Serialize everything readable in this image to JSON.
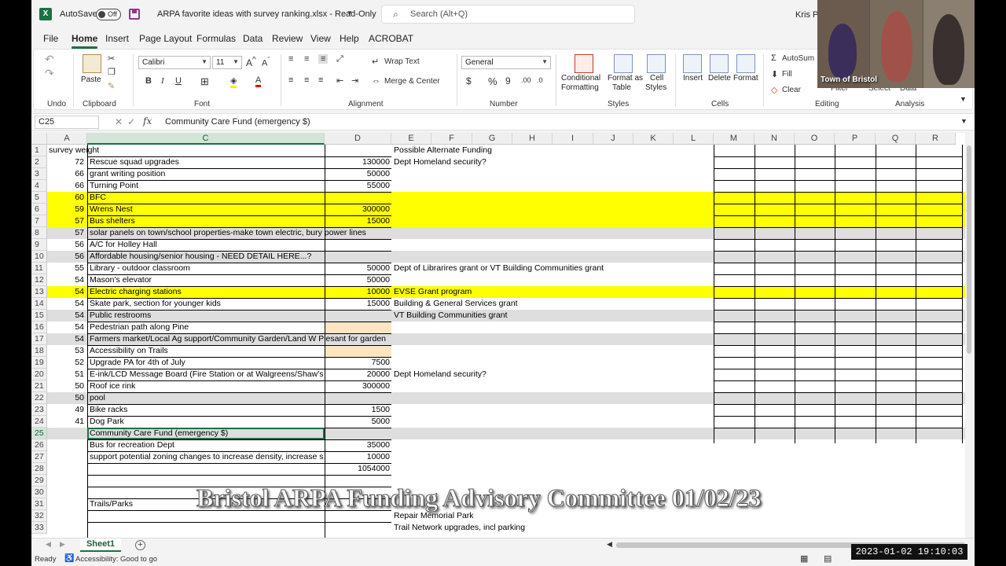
{
  "titlebar": {
    "autosave_label": "AutoSave",
    "autosave_state": "Off",
    "doc_title": "ARPA favorite ideas with survey ranking.xlsx  -  Read-Only",
    "search_placeholder": "Search (Alt+Q)",
    "user_name": "Kris Pe"
  },
  "menu": [
    "File",
    "Home",
    "Insert",
    "Page Layout",
    "Formulas",
    "Data",
    "Review",
    "View",
    "Help",
    "ACROBAT"
  ],
  "ribbon": {
    "undo_label": "Undo",
    "clipboard_label": "Clipboard",
    "paste_label": "Paste",
    "font_label": "Font",
    "font_name": "Calibri",
    "font_size": "11",
    "alignment_label": "Alignment",
    "wrap_text": "Wrap Text",
    "merge_center": "Merge & Center",
    "number_label": "Number",
    "number_format": "General",
    "styles_label": "Styles",
    "conditional_formatting": [
      "Conditional",
      "Formatting"
    ],
    "format_as_table": [
      "Format as",
      "Table"
    ],
    "cell_styles": [
      "Cell",
      "Styles"
    ],
    "cells_label": "Cells",
    "insert": "Insert",
    "delete": "Delete",
    "format": "Format",
    "editing_label": "Editing",
    "autosum": "AutoSum",
    "fill": "Fill",
    "clear": "Clear",
    "filter": "Filter",
    "select": "Select",
    "data": "Data",
    "analysis_label": "Analysis"
  },
  "formula_bar": {
    "name_box": "C25",
    "fx": "fx",
    "content": "Community Care Fund (emergency $)"
  },
  "columns": [
    "A",
    "C",
    "D",
    "E",
    "F",
    "G",
    "H",
    "I",
    "J",
    "K",
    "L",
    "M",
    "N",
    "O",
    "P",
    "Q",
    "R"
  ],
  "rows": [
    {
      "n": "1",
      "a": "survey weight",
      "c": "",
      "d": "",
      "e": "Possible Alternate Funding",
      "style": ""
    },
    {
      "n": "2",
      "a": "72",
      "c": "Rescue squad upgrades",
      "d": "130000",
      "e": "Dept Homeland security?",
      "style": ""
    },
    {
      "n": "3",
      "a": "66",
      "c": "grant writing position",
      "d": "50000",
      "e": "",
      "style": ""
    },
    {
      "n": "4",
      "a": "66",
      "c": "Turning Point",
      "d": "55000",
      "e": "",
      "style": ""
    },
    {
      "n": "5",
      "a": "60",
      "c": "BFC",
      "d": "",
      "e": "",
      "style": "yellow"
    },
    {
      "n": "6",
      "a": "59",
      "c": "Wrens Nest",
      "d": "300000",
      "e": "",
      "style": "yellow"
    },
    {
      "n": "7",
      "a": "57",
      "c": "Bus shelters",
      "d": "15000",
      "e": "",
      "style": "yellow"
    },
    {
      "n": "8",
      "a": "57",
      "c": "solar panels on town/school properties-make town electric, bury power lines",
      "d": "",
      "e": "",
      "style": "gray"
    },
    {
      "n": "9",
      "a": "56",
      "c": "A/C for Holley Hall",
      "d": "",
      "e": "",
      "style": ""
    },
    {
      "n": "10",
      "a": "56",
      "c": "Affordable housing/senior housing - NEED DETAIL HERE...?",
      "d": "",
      "e": "",
      "style": "gray"
    },
    {
      "n": "11",
      "a": "55",
      "c": "Library - outdoor classroom",
      "d": "50000",
      "e": "Dept of Librarires grant or VT Building Communities grant",
      "style": ""
    },
    {
      "n": "12",
      "a": "54",
      "c": "Mason's elevator",
      "d": "50000",
      "e": "",
      "style": ""
    },
    {
      "n": "13",
      "a": "54",
      "c": "Electric charging stations",
      "d": "10000",
      "e": "EVSE Grant program",
      "style": "yellow"
    },
    {
      "n": "14",
      "a": "54",
      "c": "Skate park, section for younger kids",
      "d": "15000",
      "e": "Building & General Services grant",
      "style": ""
    },
    {
      "n": "15",
      "a": "54",
      "c": "Public restrooms",
      "d": "",
      "e": "VT Building Communities grant",
      "style": "gray"
    },
    {
      "n": "16",
      "a": "54",
      "c": "Pedestrian path along Pine",
      "d": "",
      "e": "",
      "style": "tan"
    },
    {
      "n": "17",
      "a": "54",
      "c": "Farmers market/Local Ag support/Community Garden/Land W Plesant for garden",
      "d": "",
      "e": "",
      "style": "gray"
    },
    {
      "n": "18",
      "a": "53",
      "c": "Accessibility on Trails",
      "d": "",
      "e": "",
      "style": "tan"
    },
    {
      "n": "19",
      "a": "52",
      "c": "Upgrade PA for 4th of July",
      "d": "7500",
      "e": "",
      "style": ""
    },
    {
      "n": "20",
      "a": "51",
      "c": "E-ink/LCD Message Board (Fire Station or at Walgreens/Shaw's sig",
      "d": "20000",
      "e": "Dept Homeland security?",
      "style": ""
    },
    {
      "n": "21",
      "a": "50",
      "c": "Roof ice rink",
      "d": "300000",
      "e": "",
      "style": ""
    },
    {
      "n": "22",
      "a": "50",
      "c": "pool",
      "d": "",
      "e": "",
      "style": "gray"
    },
    {
      "n": "23",
      "a": "49",
      "c": "Bike racks",
      "d": "1500",
      "e": "",
      "style": ""
    },
    {
      "n": "24",
      "a": "41",
      "c": "Dog Park",
      "d": "5000",
      "e": "",
      "style": ""
    },
    {
      "n": "25",
      "a": "",
      "c": "Community Care Fund (emergency $)",
      "d": "",
      "e": "",
      "style": "gray"
    },
    {
      "n": "26",
      "a": "",
      "c": "Bus for recreation Dept",
      "d": "35000",
      "e": "",
      "style": ""
    },
    {
      "n": "27",
      "a": "",
      "c": "support potential zoning changes to increase density, increase sew",
      "d": "10000",
      "e": "",
      "style": ""
    },
    {
      "n": "28",
      "a": "",
      "c": "",
      "d": "1054000",
      "e": "",
      "style": ""
    },
    {
      "n": "29",
      "a": "",
      "c": "",
      "d": "",
      "e": "",
      "style": ""
    },
    {
      "n": "30",
      "a": "",
      "c": "",
      "d": "",
      "e": "",
      "style": ""
    },
    {
      "n": "31",
      "a": "",
      "c": "Trails/Parks",
      "d": "",
      "e": "",
      "style": ""
    },
    {
      "n": "32",
      "a": "",
      "c": "",
      "d": "",
      "e": "Repair Memorial Park",
      "style": ""
    },
    {
      "n": "33",
      "a": "",
      "c": "",
      "d": "",
      "e": "Trail Network upgrades, incl parking",
      "style": ""
    }
  ],
  "overlay_title": "Bristol ARPA Funding Advisory Committee 01/02/23",
  "sheet_tab": "Sheet1",
  "status": {
    "ready": "Ready",
    "accessibility": "Accessibility: Good to go"
  },
  "video": {
    "label": "Town of Bristol"
  },
  "timestamp": "2023-01-02  19:10:03",
  "colors": {
    "excel_green": "#1d7044",
    "highlight_yellow": "#ffff00",
    "highlight_gray": "#dedede",
    "highlight_tan": "#fbe5c2"
  }
}
